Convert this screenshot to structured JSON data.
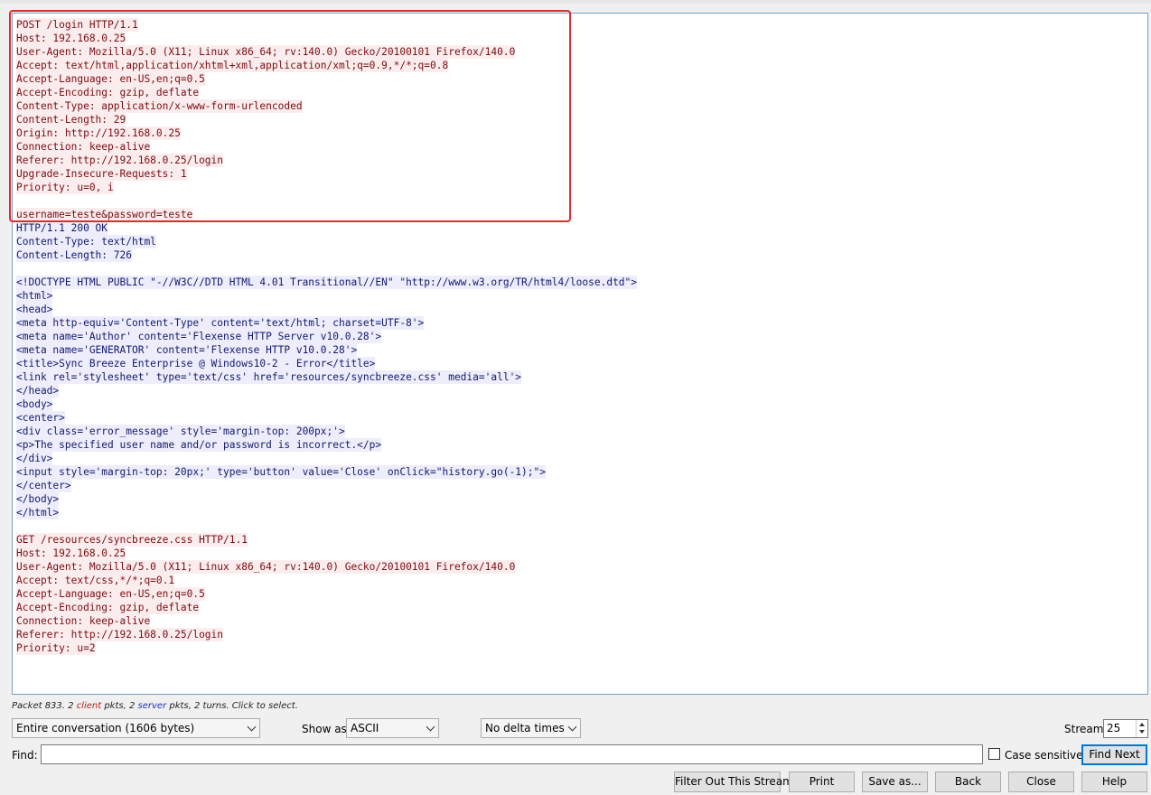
{
  "stream": {
    "lines": [
      {
        "d": "c",
        "t": "POST /login HTTP/1.1"
      },
      {
        "d": "c",
        "t": "Host: 192.168.0.25"
      },
      {
        "d": "c",
        "t": "User-Agent: Mozilla/5.0 (X11; Linux x86_64; rv:140.0) Gecko/20100101 Firefox/140.0"
      },
      {
        "d": "c",
        "t": "Accept: text/html,application/xhtml+xml,application/xml;q=0.9,*/*;q=0.8"
      },
      {
        "d": "c",
        "t": "Accept-Language: en-US,en;q=0.5"
      },
      {
        "d": "c",
        "t": "Accept-Encoding: gzip, deflate"
      },
      {
        "d": "c",
        "t": "Content-Type: application/x-www-form-urlencoded"
      },
      {
        "d": "c",
        "t": "Content-Length: 29"
      },
      {
        "d": "c",
        "t": "Origin: http://192.168.0.25"
      },
      {
        "d": "c",
        "t": "Connection: keep-alive"
      },
      {
        "d": "c",
        "t": "Referer: http://192.168.0.25/login"
      },
      {
        "d": "c",
        "t": "Upgrade-Insecure-Requests: 1"
      },
      {
        "d": "c",
        "t": "Priority: u=0, i"
      },
      {
        "d": "c",
        "t": ""
      },
      {
        "d": "c",
        "t": "username=teste&password=teste"
      },
      {
        "d": "s",
        "t": "HTTP/1.1 200 OK"
      },
      {
        "d": "s",
        "t": "Content-Type: text/html"
      },
      {
        "d": "s",
        "t": "Content-Length: 726"
      },
      {
        "d": "s",
        "t": ""
      },
      {
        "d": "s",
        "t": "<!DOCTYPE HTML PUBLIC \"-//W3C//DTD HTML 4.01 Transitional//EN\" \"http://www.w3.org/TR/html4/loose.dtd\">"
      },
      {
        "d": "s",
        "t": "<html>"
      },
      {
        "d": "s",
        "t": "<head>"
      },
      {
        "d": "s",
        "t": "<meta http-equiv='Content-Type' content='text/html; charset=UTF-8'>"
      },
      {
        "d": "s",
        "t": "<meta name='Author' content='Flexense HTTP Server v10.0.28'>"
      },
      {
        "d": "s",
        "t": "<meta name='GENERATOR' content='Flexense HTTP v10.0.28'>"
      },
      {
        "d": "s",
        "t": "<title>Sync Breeze Enterprise @ Windows10-2 - Error</title>"
      },
      {
        "d": "s",
        "t": "<link rel='stylesheet' type='text/css' href='resources/syncbreeze.css' media='all'>"
      },
      {
        "d": "s",
        "t": "</head>"
      },
      {
        "d": "s",
        "t": "<body>"
      },
      {
        "d": "s",
        "t": "<center>"
      },
      {
        "d": "s",
        "t": "<div class='error_message' style='margin-top: 200px;'>"
      },
      {
        "d": "s",
        "t": "<p>The specified user name and/or password is incorrect.</p>"
      },
      {
        "d": "s",
        "t": "</div>"
      },
      {
        "d": "s",
        "t": "<input style='margin-top: 20px;' type='button' value='Close' onClick=\"history.go(-1);\">"
      },
      {
        "d": "s",
        "t": "</center>"
      },
      {
        "d": "s",
        "t": "</body>"
      },
      {
        "d": "s",
        "t": "</html>"
      },
      {
        "d": "s",
        "t": ""
      },
      {
        "d": "c",
        "t": "GET /resources/syncbreeze.css HTTP/1.1"
      },
      {
        "d": "c",
        "t": "Host: 192.168.0.25"
      },
      {
        "d": "c",
        "t": "User-Agent: Mozilla/5.0 (X11; Linux x86_64; rv:140.0) Gecko/20100101 Firefox/140.0"
      },
      {
        "d": "c",
        "t": "Accept: text/css,*/*;q=0.1"
      },
      {
        "d": "c",
        "t": "Accept-Language: en-US,en;q=0.5"
      },
      {
        "d": "c",
        "t": "Accept-Encoding: gzip, deflate"
      },
      {
        "d": "c",
        "t": "Connection: keep-alive"
      },
      {
        "d": "c",
        "t": "Referer: http://192.168.0.25/login"
      },
      {
        "d": "c",
        "t": "Priority: u=2"
      }
    ]
  },
  "status": {
    "prefix": "Packet 833. 2 ",
    "client_word": "client",
    "mid": " pkts, 2 ",
    "server_word": "server",
    "suffix": " pkts, 2 turns. Click to select."
  },
  "controls": {
    "conversation_select": "Entire conversation (1606 bytes)",
    "show_as_label": "Show as",
    "show_as_value": "ASCII",
    "delta_select": "No delta times",
    "stream_label": "Stream",
    "stream_value": "25",
    "find_label": "Find:",
    "find_value": "",
    "case_sensitive_label": "Case sensitive",
    "find_next": "Find Next"
  },
  "buttons": {
    "filter_out": "Filter Out This Stream",
    "print": "Print",
    "save_as": "Save as...",
    "back": "Back",
    "close": "Close",
    "help": "Help"
  },
  "colors": {
    "client_text": "#7a0c12",
    "client_bg": "#fbeded",
    "server_text": "#141a6e",
    "server_bg": "#ededfb",
    "highlight_border": "#d9302f"
  }
}
